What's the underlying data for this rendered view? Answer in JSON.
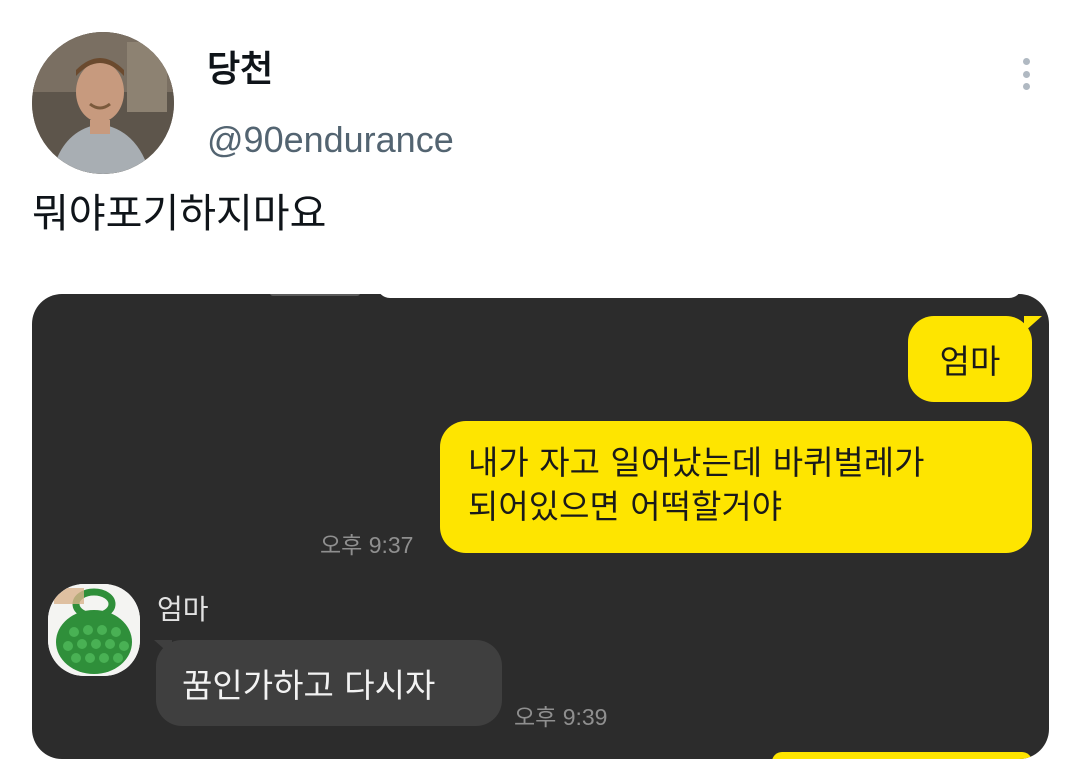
{
  "tweet": {
    "display_name": "당천",
    "handle": "@90endurance",
    "text": "뭐야포기하지마요",
    "more_icon": "more-vertical-icon"
  },
  "chat": {
    "messages": [
      {
        "from": "me",
        "text": "엄마"
      },
      {
        "from": "me",
        "lines": [
          "내가 자고 일어났는데 바퀴벌레가",
          "되어있으면 어떡할거야"
        ],
        "time": "오후 9:37"
      },
      {
        "from": "엄마",
        "sender_name": "엄마",
        "text": "꿈인가하고 다시자",
        "time": "오후 9:39"
      }
    ],
    "colors": {
      "my_bubble": "#fee500",
      "their_bubble": "#3f3f3f",
      "background": "#2c2c2c"
    }
  }
}
